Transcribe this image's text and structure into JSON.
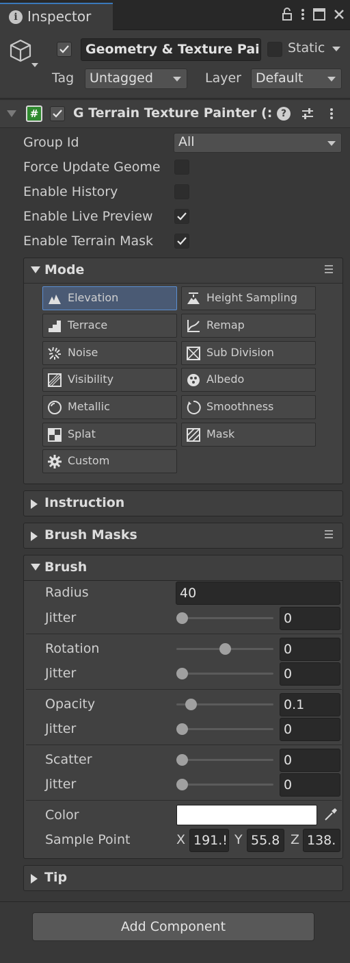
{
  "window": {
    "tab_label": "Inspector",
    "icons": [
      "lock-icon",
      "more-vertical-icon",
      "maximize-icon",
      "close-icon"
    ]
  },
  "object": {
    "active": true,
    "name": "Geometry & Texture Pai",
    "static_label": "Static",
    "static_checked": false,
    "tag_label": "Tag",
    "tag_value": "Untagged",
    "layer_label": "Layer",
    "layer_value": "Default"
  },
  "component": {
    "enabled": true,
    "title": "G Terrain Texture Painter (:",
    "properties": [
      {
        "label": "Group Id",
        "type": "dropdown",
        "value": "All"
      },
      {
        "label": "Force Update Geome",
        "type": "toggle",
        "checked": false
      },
      {
        "label": "Enable History",
        "type": "toggle",
        "checked": false
      },
      {
        "label": "Enable Live Preview",
        "type": "toggle",
        "checked": true
      },
      {
        "label": "Enable Terrain Mask",
        "type": "toggle",
        "checked": true
      }
    ]
  },
  "mode_section": {
    "title": "Mode",
    "selected": "Elevation",
    "buttons": [
      {
        "label": "Elevation",
        "icon": "elevation-icon"
      },
      {
        "label": "Height Sampling",
        "icon": "height-sampling-icon"
      },
      {
        "label": "Terrace",
        "icon": "terrace-icon"
      },
      {
        "label": "Remap",
        "icon": "remap-icon"
      },
      {
        "label": "Noise",
        "icon": "noise-icon"
      },
      {
        "label": "Sub Division",
        "icon": "sub-division-icon"
      },
      {
        "label": "Visibility",
        "icon": "visibility-icon"
      },
      {
        "label": "Albedo",
        "icon": "albedo-icon"
      },
      {
        "label": "Metallic",
        "icon": "metallic-icon"
      },
      {
        "label": "Smoothness",
        "icon": "smoothness-icon"
      },
      {
        "label": "Splat",
        "icon": "splat-icon"
      },
      {
        "label": "Mask",
        "icon": "mask-icon"
      },
      {
        "label": "Custom",
        "icon": "gear-icon"
      }
    ]
  },
  "instruction_section": {
    "title": "Instruction"
  },
  "brush_masks_section": {
    "title": "Brush Masks"
  },
  "brush_section": {
    "title": "Brush",
    "radius": {
      "label": "Radius",
      "value": "40"
    },
    "rows": [
      {
        "label": "Jitter",
        "value": "0",
        "fraction": 0.0
      },
      {
        "label": "Rotation",
        "value": "0",
        "fraction": 0.5
      },
      {
        "label": "Jitter",
        "value": "0",
        "fraction": 0.0
      },
      {
        "label": "Opacity",
        "value": "0.1",
        "fraction": 0.1
      },
      {
        "label": "Jitter",
        "value": "0",
        "fraction": 0.0
      },
      {
        "label": "Scatter",
        "value": "0",
        "fraction": 0.0
      },
      {
        "label": "Jitter",
        "value": "0",
        "fraction": 0.0
      }
    ],
    "color_label": "Color",
    "color_value": "#ffffff",
    "sample_point": {
      "label": "Sample Point",
      "x_label": "X",
      "x": "191.!",
      "y_label": "Y",
      "y": "55.8",
      "z_label": "Z",
      "z": "138."
    }
  },
  "tip_section": {
    "title": "Tip"
  },
  "add_component_label": "Add Component",
  "colors": {
    "selection_accent": "#5b8ed1",
    "panel_bg": "#383838"
  }
}
